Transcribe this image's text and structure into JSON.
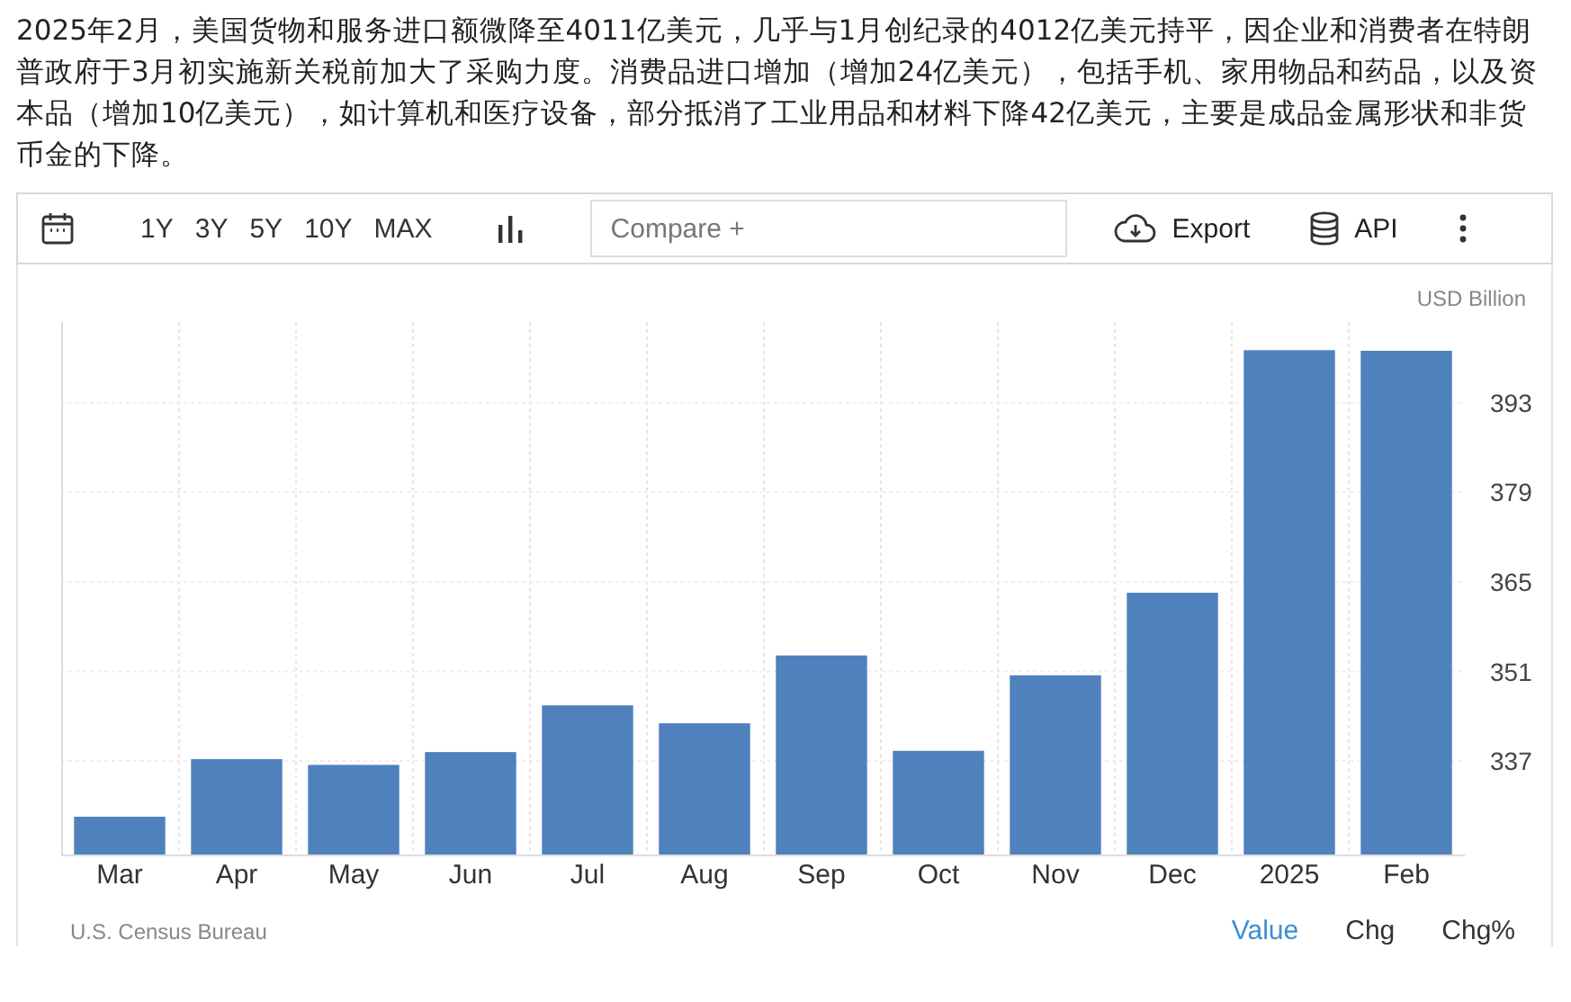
{
  "description": "2025年2月，美国货物和服务进口额微降至4011亿美元，几乎与1月创纪录的4012亿美元持平，因企业和消费者在特朗普政府于3月初实施新关税前加大了采购力度。消费品进口增加（增加24亿美元），包括手机、家用物品和药品，以及资本品（增加10亿美元），如计算机和医疗设备，部分抵消了工业用品和材料下降42亿美元，主要是成品金属形状和非货币金的下降。",
  "toolbar": {
    "ranges": [
      "1Y",
      "3Y",
      "5Y",
      "10Y",
      "MAX"
    ],
    "compare": {
      "placeholder": "Compare +"
    },
    "export": "Export",
    "api": "API"
  },
  "chart": {
    "unit": "USD Billion",
    "chart_data": {
      "type": "bar",
      "categories": [
        "Mar",
        "Apr",
        "May",
        "Jun",
        "Jul",
        "Aug",
        "Sep",
        "Oct",
        "Nov",
        "Dec",
        "2025",
        "Feb"
      ],
      "grid": true,
      "series": [
        {
          "color": "#4f81bd",
          "values": [
            328.3,
            337.3,
            336.4,
            338.4,
            345.7,
            342.9,
            353.5,
            338.6,
            350.4,
            363.3,
            401.2,
            401.1
          ]
        }
      ],
      "ylim": [
        322.4,
        405.6
      ],
      "yticks": [
        337,
        351,
        365,
        379,
        393
      ]
    }
  },
  "source": "U.S. Census Bureau",
  "modes": [
    {
      "label": "Value",
      "selected": true
    },
    {
      "label": "Chg",
      "selected": false
    },
    {
      "label": "Chg%",
      "selected": false
    }
  ]
}
